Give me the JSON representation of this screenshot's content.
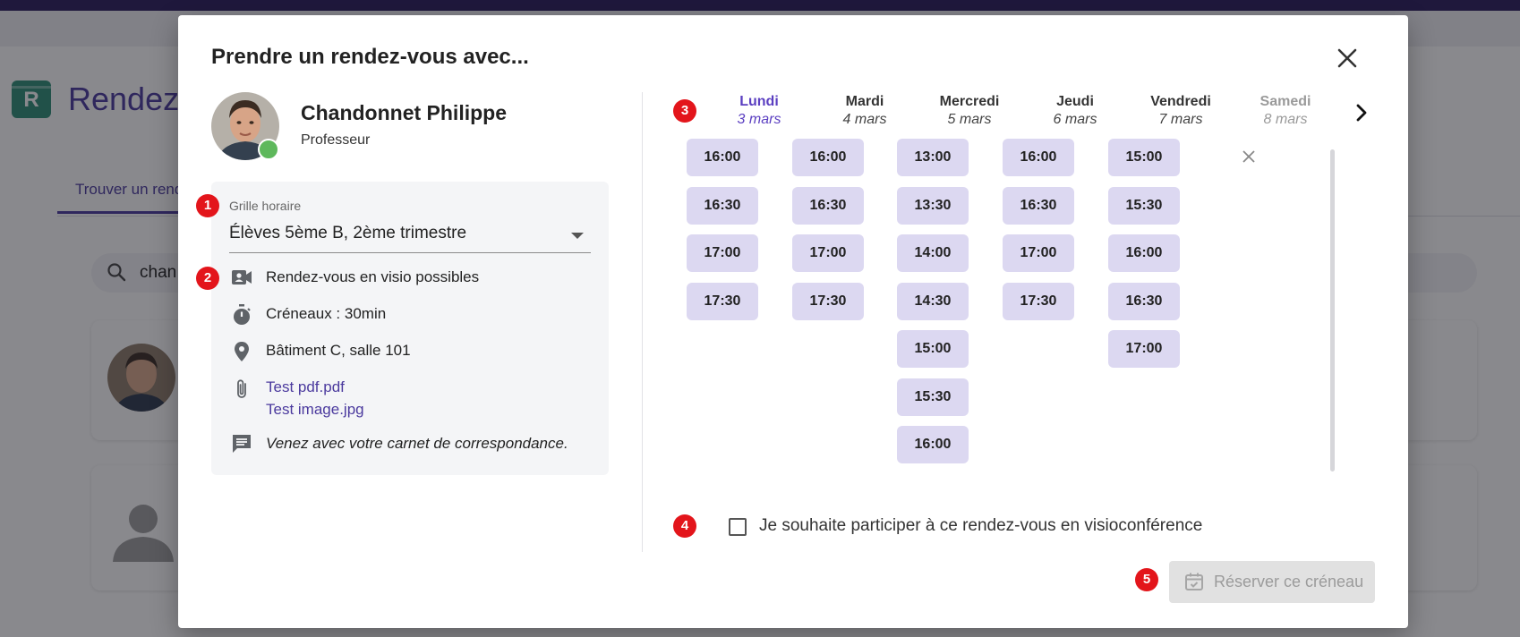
{
  "background": {
    "app_title": "Rendez-",
    "tab_label": "Trouver un rend",
    "search_value": "chan"
  },
  "dialog": {
    "title": "Prendre un rendez-vous avec...",
    "close_icon": "close-icon"
  },
  "badges": [
    "1",
    "2",
    "3",
    "4",
    "5"
  ],
  "teacher": {
    "name": "Chandonnet Philippe",
    "role": "Professeur",
    "status_color": "#5eb85c"
  },
  "schedule": {
    "label": "Grille horaire",
    "value": "Élèves 5ème B, 2ème trimestre"
  },
  "info": {
    "visio": "Rendez-vous en visio possibles",
    "duration": "Créneaux : 30min",
    "location": "Bâtiment C, salle 101",
    "attachments": [
      "Test pdf.pdf",
      "Test image.jpg"
    ],
    "note": "Venez avec votre carnet de correspondance."
  },
  "days": [
    {
      "name": "Lundi",
      "date": "3 mars",
      "state": "active",
      "slots": [
        "16:00",
        "16:30",
        "17:00",
        "17:30"
      ]
    },
    {
      "name": "Mardi",
      "date": "4 mars",
      "state": "normal",
      "slots": [
        "16:00",
        "16:30",
        "17:00",
        "17:30"
      ]
    },
    {
      "name": "Mercredi",
      "date": "5 mars",
      "state": "normal",
      "slots": [
        "13:00",
        "13:30",
        "14:00",
        "14:30",
        "15:00",
        "15:30",
        "16:00"
      ]
    },
    {
      "name": "Jeudi",
      "date": "6 mars",
      "state": "normal",
      "slots": [
        "16:00",
        "16:30",
        "17:00",
        "17:30"
      ]
    },
    {
      "name": "Vendredi",
      "date": "7 mars",
      "state": "normal",
      "slots": [
        "15:00",
        "15:30",
        "16:00",
        "16:30",
        "17:00"
      ]
    },
    {
      "name": "Samedi",
      "date": "8 mars",
      "state": "disabled",
      "slots": []
    }
  ],
  "visio_checkbox": {
    "label": "Je souhaite participer à ce rendez-vous en visioconférence",
    "checked": false
  },
  "reserve_button": {
    "label": "Réserver ce créneau",
    "enabled": false
  },
  "colors": {
    "accent": "#4b3a9e",
    "slot_bg": "#dcd8f1",
    "badge": "#e3151b"
  }
}
